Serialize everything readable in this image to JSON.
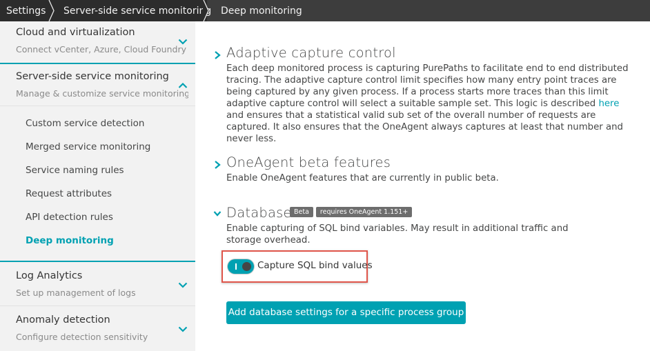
{
  "breadcrumb": {
    "items": [
      "Settings",
      "Server-side service monitoring",
      "Deep monitoring"
    ]
  },
  "sidebar": {
    "groups": [
      {
        "title": "Cloud and virtualization",
        "subtitle": "Connect vCenter, Azure, Cloud Foundry o...",
        "expanded": false
      },
      {
        "title": "Server-side service monitoring",
        "subtitle": "Manage & customize service monitoring",
        "expanded": true
      },
      {
        "title": "Log Analytics",
        "subtitle": "Set up management of logs",
        "expanded": false
      },
      {
        "title": "Anomaly detection",
        "subtitle": "Configure detection sensitivity",
        "expanded": false
      }
    ],
    "sub_items": [
      {
        "label": "Custom service detection",
        "active": false
      },
      {
        "label": "Merged service monitoring",
        "active": false
      },
      {
        "label": "Service naming rules",
        "active": false
      },
      {
        "label": "Request attributes",
        "active": false
      },
      {
        "label": "API detection rules",
        "active": false
      },
      {
        "label": "Deep monitoring",
        "active": true
      }
    ]
  },
  "main": {
    "adaptive": {
      "title": "Adaptive capture control",
      "body_before_link": "Each deep monitored process is capturing PurePaths to facilitate end to end distributed tracing. The adaptive capture control limit specifies how many entry point traces are being captured by any given process. If a process starts more traces than this limit adaptive capture control will select a suitable sample set. This logic is described ",
      "link": "here",
      "body_after_link": " and ensures that a statistical valid sub set of the overall number of requests are captured. It also ensures that the OneAgent always captures at least that number and never less."
    },
    "beta": {
      "title": "OneAgent beta features",
      "body": "Enable OneAgent features that are currently in public beta."
    },
    "database": {
      "title": "Database",
      "badges": [
        "Beta",
        "requires OneAgent 1.151+"
      ],
      "body": "Enable capturing of SQL bind variables. May result in additional traffic and storage overhead.",
      "toggle_label": "Capture SQL bind values",
      "toggle_on": true,
      "button_label": "Add database settings for a specific process group"
    }
  },
  "colors": {
    "accent": "#00a1b2",
    "highlight_border": "#e0554a",
    "breadcrumb_bg": "#2c2c2c",
    "sidebar_bg": "#f2f2f2"
  }
}
